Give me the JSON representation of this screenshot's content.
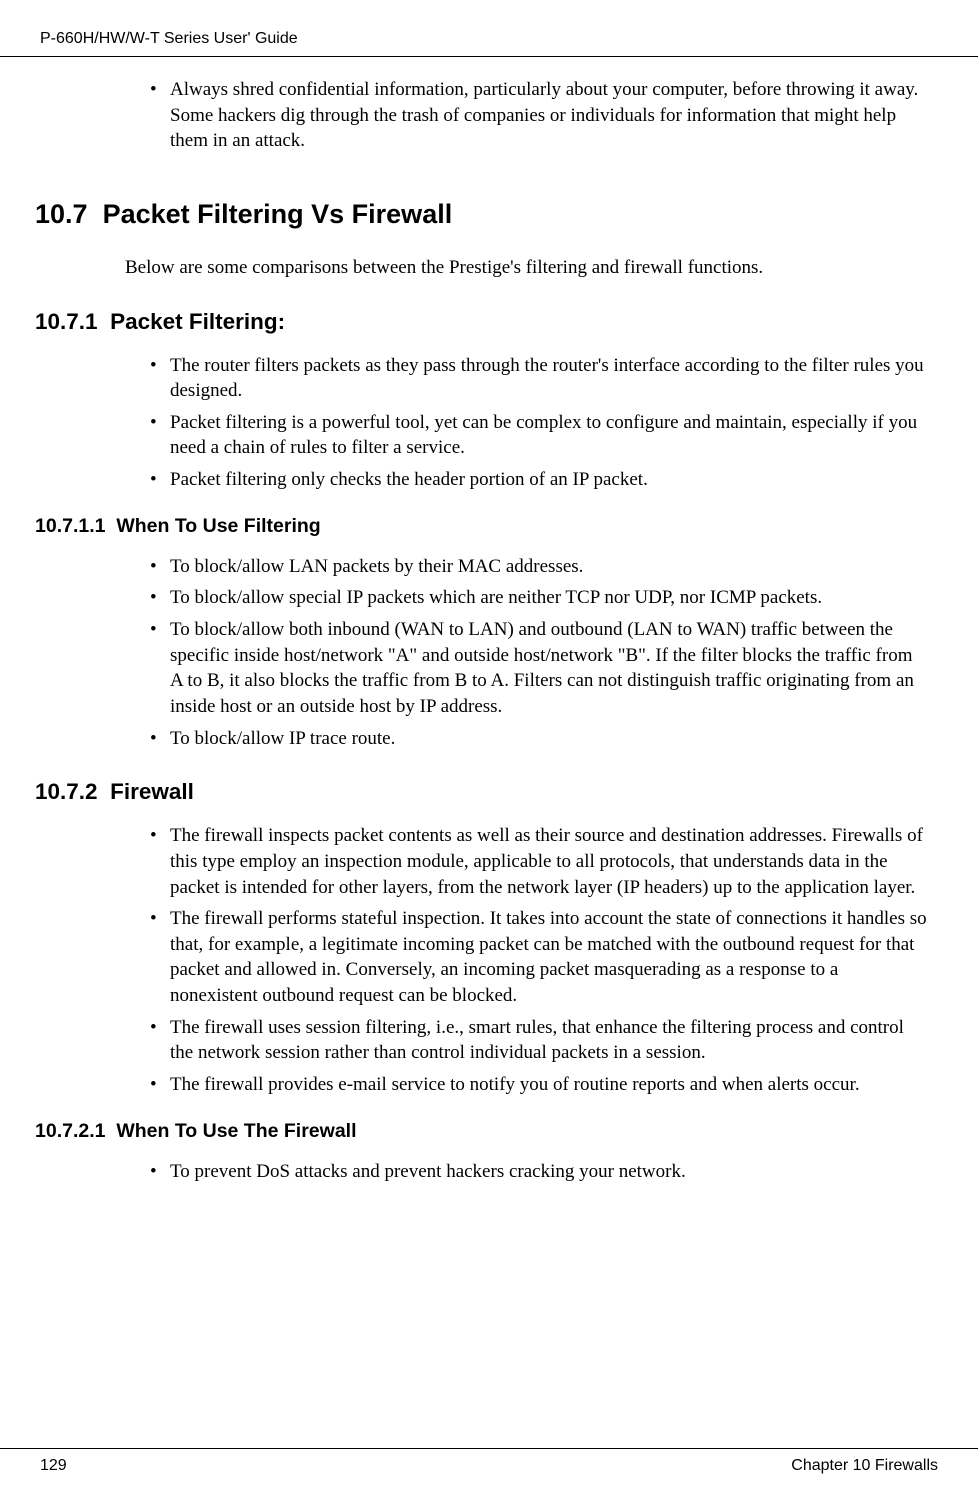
{
  "header": {
    "title": "P-660H/HW/W-T Series User' Guide"
  },
  "top_bullets": {
    "items": [
      "Always shred confidential information, particularly about your computer, before throwing it away. Some hackers dig through the trash of companies or individuals for information that might help them in an attack."
    ]
  },
  "section_10_7": {
    "number": "10.7",
    "title": "Packet Filtering Vs Firewall",
    "intro": "Below are some comparisons between the Prestige's filtering and firewall functions."
  },
  "section_10_7_1": {
    "number": "10.7.1",
    "title": "Packet Filtering:",
    "bullets": [
      "The router filters packets as they pass through the router's interface according to the filter rules you designed.",
      "Packet filtering is a powerful tool, yet can be complex to configure and maintain, especially if you need a chain of rules to filter a service.",
      "Packet filtering only checks the header portion of an IP packet."
    ]
  },
  "section_10_7_1_1": {
    "number": "10.7.1.1",
    "title": "When To Use Filtering",
    "bullets": [
      "To block/allow LAN packets by their MAC addresses.",
      "To block/allow special IP packets which are neither TCP nor UDP, nor ICMP packets.",
      "To block/allow both inbound (WAN to LAN) and outbound (LAN to WAN) traffic between the specific inside host/network \"A\" and outside host/network \"B\". If the filter blocks the traffic from A to B, it also blocks the traffic from B to A. Filters can not distinguish traffic originating from an inside host or an outside host by IP address.",
      "To block/allow IP trace route."
    ]
  },
  "section_10_7_2": {
    "number": "10.7.2",
    "title": "Firewall",
    "bullets": [
      "The firewall inspects packet contents as well as their source and destination addresses. Firewalls of this type employ an inspection module, applicable to all protocols, that understands data in the packet is intended for other layers, from the network layer (IP headers) up to the application layer.",
      "The firewall performs stateful inspection. It takes into account the state of connections it handles so that, for example, a legitimate incoming packet can be matched with the outbound request for that packet and allowed in. Conversely, an incoming packet masquerading as a response to a nonexistent outbound request can be blocked.",
      "The firewall uses session filtering, i.e., smart rules, that enhance the filtering process and control the network session rather than control individual packets in a session.",
      "The firewall provides e-mail service to notify you of routine reports and when alerts occur."
    ]
  },
  "section_10_7_2_1": {
    "number": "10.7.2.1",
    "title": "When To Use The Firewall",
    "bullets": [
      "To prevent DoS attacks and prevent hackers cracking your network."
    ]
  },
  "footer": {
    "page_number": "129",
    "chapter": "Chapter 10 Firewalls"
  }
}
